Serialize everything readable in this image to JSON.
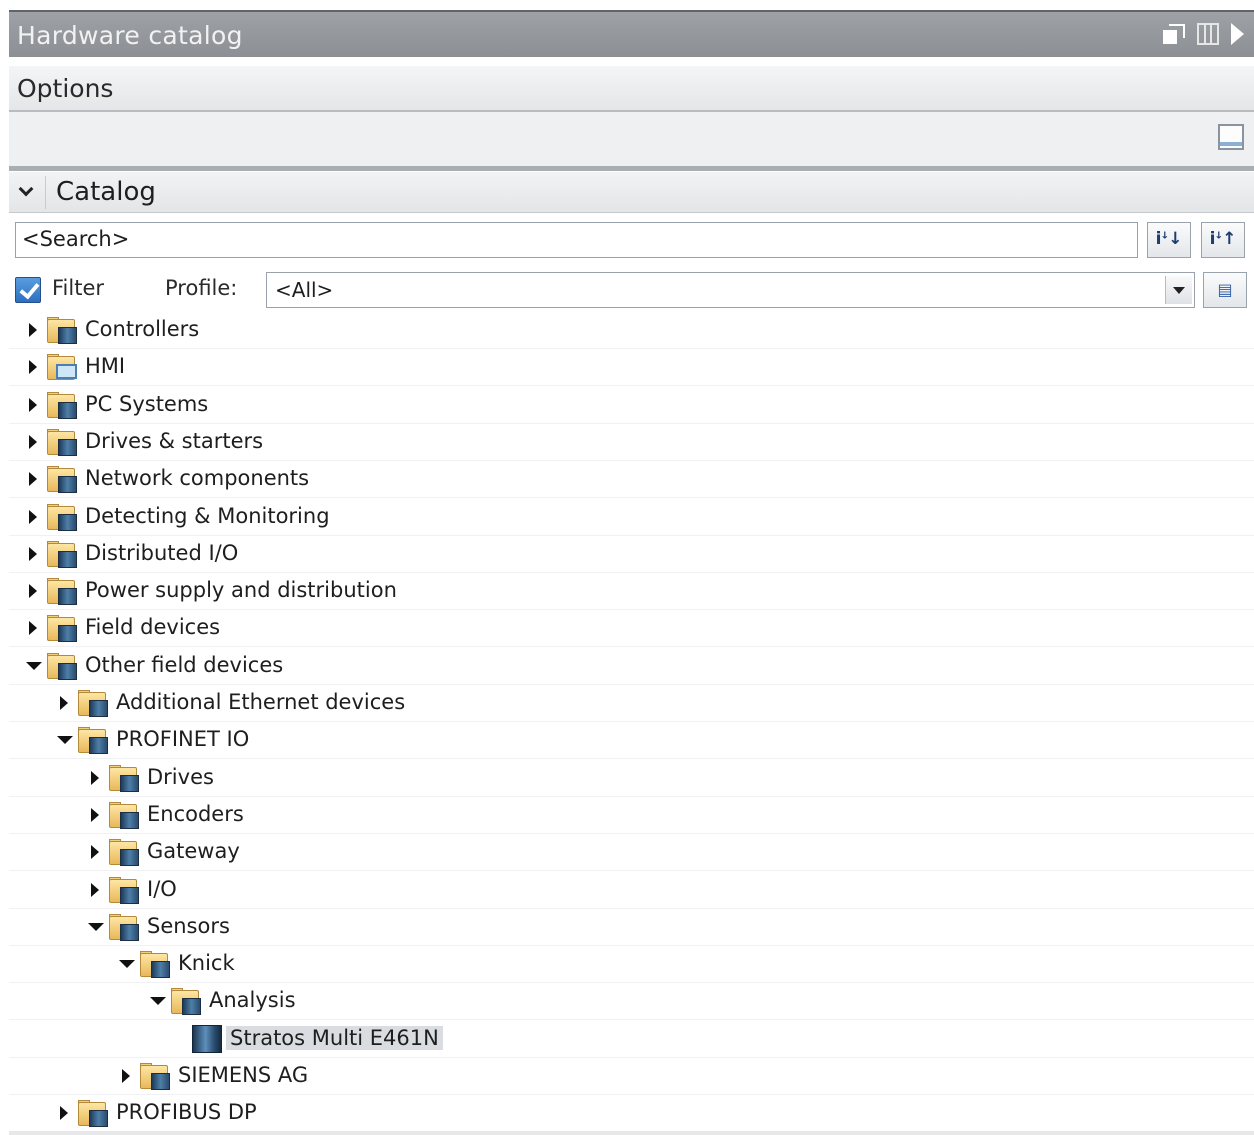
{
  "window": {
    "title": "Hardware catalog",
    "controls": [
      "float-window-icon",
      "split-view-icon",
      "collapse-arrow-icon"
    ]
  },
  "options": {
    "label": "Options"
  },
  "catalog": {
    "label": "Catalog",
    "search": {
      "placeholder": "<Search>"
    },
    "search_buttons": [
      {
        "name": "search-down-button",
        "icon": "search-down-icon"
      },
      {
        "name": "search-up-button",
        "icon": "search-up-icon"
      }
    ],
    "filter": {
      "label": "Filter",
      "checked": true
    },
    "profile": {
      "label": "Profile:",
      "value": "<All>"
    }
  },
  "tree": [
    {
      "label": "Controllers",
      "level": 0,
      "state": "collapsed",
      "icon": "folder-device-icon"
    },
    {
      "label": "HMI",
      "level": 0,
      "state": "collapsed",
      "icon": "folder-hmi-icon"
    },
    {
      "label": "PC Systems",
      "level": 0,
      "state": "collapsed",
      "icon": "folder-device-icon"
    },
    {
      "label": "Drives & starters",
      "level": 0,
      "state": "collapsed",
      "icon": "folder-device-icon"
    },
    {
      "label": "Network components",
      "level": 0,
      "state": "collapsed",
      "icon": "folder-device-icon"
    },
    {
      "label": "Detecting & Monitoring",
      "level": 0,
      "state": "collapsed",
      "icon": "folder-device-icon"
    },
    {
      "label": "Distributed I/O",
      "level": 0,
      "state": "collapsed",
      "icon": "folder-device-icon"
    },
    {
      "label": "Power supply and distribution",
      "level": 0,
      "state": "collapsed",
      "icon": "folder-device-icon"
    },
    {
      "label": "Field devices",
      "level": 0,
      "state": "collapsed",
      "icon": "folder-device-icon"
    },
    {
      "label": "Other field devices",
      "level": 0,
      "state": "expanded",
      "icon": "folder-device-icon"
    },
    {
      "label": "Additional Ethernet devices",
      "level": 1,
      "state": "collapsed",
      "icon": "folder-device-icon"
    },
    {
      "label": "PROFINET IO",
      "level": 1,
      "state": "expanded",
      "icon": "folder-device-icon"
    },
    {
      "label": "Drives",
      "level": 2,
      "state": "collapsed",
      "icon": "folder-device-icon"
    },
    {
      "label": "Encoders",
      "level": 2,
      "state": "collapsed",
      "icon": "folder-device-icon"
    },
    {
      "label": "Gateway",
      "level": 2,
      "state": "collapsed",
      "icon": "folder-device-icon"
    },
    {
      "label": "I/O",
      "level": 2,
      "state": "collapsed",
      "icon": "folder-device-icon"
    },
    {
      "label": "Sensors",
      "level": 2,
      "state": "expanded",
      "icon": "folder-device-icon"
    },
    {
      "label": "Knick",
      "level": 3,
      "state": "expanded",
      "icon": "folder-device-icon"
    },
    {
      "label": "Analysis",
      "level": 4,
      "state": "expanded",
      "icon": "folder-device-icon"
    },
    {
      "label": "Stratos Multi E461N",
      "level": 5,
      "state": "leaf",
      "icon": "device-module-icon",
      "selected": true
    },
    {
      "label": "SIEMENS AG",
      "level": 3,
      "state": "collapsed",
      "icon": "folder-device-icon"
    },
    {
      "label": "PROFIBUS DP",
      "level": 1,
      "state": "collapsed",
      "icon": "folder-device-icon"
    }
  ]
}
